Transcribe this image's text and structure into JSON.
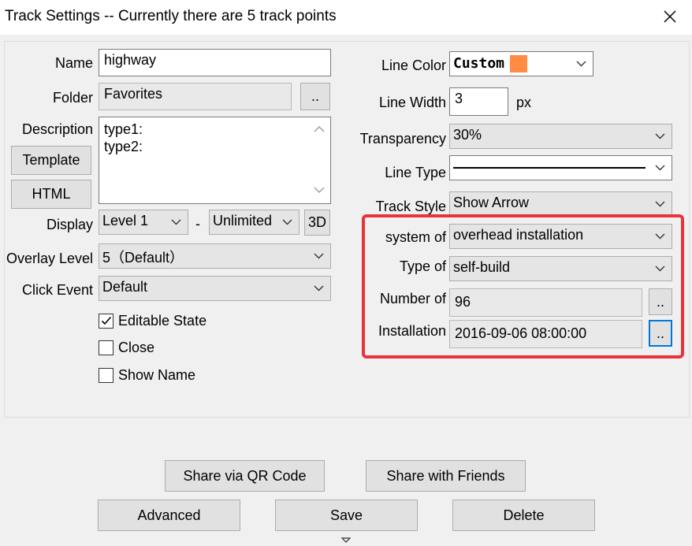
{
  "window": {
    "title": "Track Settings -- Currently there are 5 track points"
  },
  "left": {
    "name_label": "Name",
    "name_value": "highway",
    "folder_label": "Folder",
    "folder_value": "Favorites",
    "folder_browse": "..",
    "description_label": "Description",
    "description_value": "type1:\ntype2:",
    "template_button": "Template",
    "html_button": "HTML",
    "display_label": "Display",
    "display_min": "Level 1",
    "display_sep": "-",
    "display_max": "Unlimited",
    "threed_button": "3D",
    "overlay_label": "Overlay Level",
    "overlay_value": "5（Default）",
    "click_label": "Click Event",
    "click_value": "Default",
    "checks": [
      {
        "label": "Editable State",
        "checked": true
      },
      {
        "label": "Close",
        "checked": false
      },
      {
        "label": "Show Name",
        "checked": false
      }
    ]
  },
  "right": {
    "line_color_label": "Line Color",
    "line_color_value": "Custom",
    "line_color_swatch": "#ff8c42",
    "line_width_label": "Line Width",
    "line_width_value": "3",
    "line_width_unit": "px",
    "transparency_label": "Transparency",
    "transparency_value": "30%",
    "line_type_label": "Line Type",
    "track_style_label": "Track Style",
    "track_style_value": "Show Arrow"
  },
  "custom": {
    "system_label": "system of",
    "system_value": "overhead installation",
    "type_label": "Type of",
    "type_value": "self-build",
    "number_label": "Number of",
    "number_value": "96",
    "number_browse": "..",
    "install_label": "Installation",
    "install_value": "2016-09-06 08:00:00",
    "install_browse": ".."
  },
  "buttons": {
    "share_qr": "Share via QR Code",
    "share_friends": "Share with Friends",
    "advanced": "Advanced",
    "save": "Save",
    "delete": "Delete"
  },
  "colors": {
    "highlight": "#e8333b",
    "focus": "#0078d7"
  }
}
